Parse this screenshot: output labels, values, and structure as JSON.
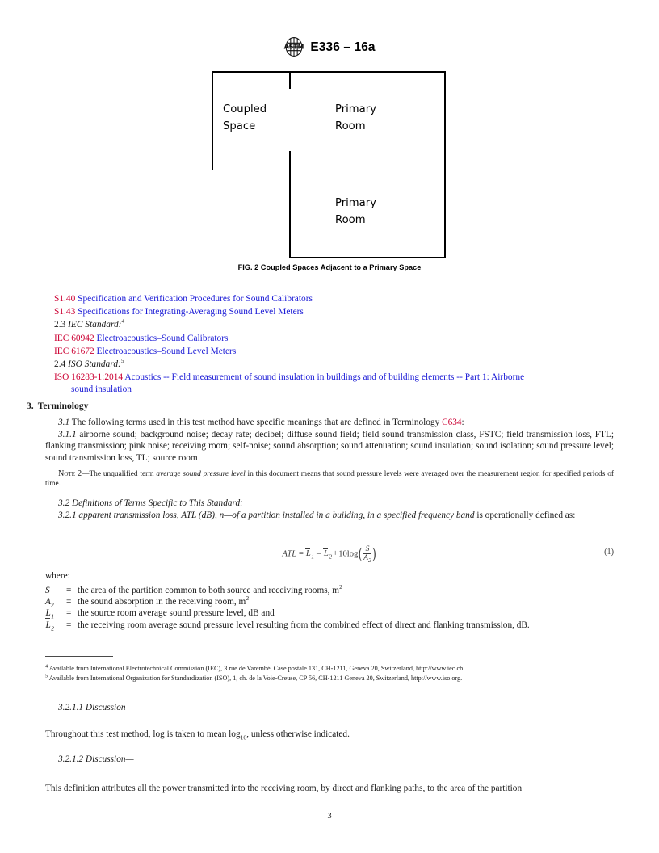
{
  "header": {
    "logo_icon": "astm-logo-icon",
    "designation": "E336 – 16a"
  },
  "figure": {
    "caption": "FIG. 2 Coupled Spaces Adjacent to a Primary Space",
    "rooms": [
      {
        "id": "coupled-space",
        "label": "Coupled\nSpace"
      },
      {
        "id": "primary-room-upper",
        "label": "Primary\nRoom"
      },
      {
        "id": "primary-room-lower",
        "label": "Primary\nRoom"
      }
    ]
  },
  "references": {
    "items": [
      {
        "designation": "S1.40",
        "title": "Specification and Verification Procedures for Sound Calibrators"
      },
      {
        "designation": "S1.43",
        "title": "Specifications for Integrating-Averaging Sound Level Meters"
      }
    ],
    "iec_heading_number": "2.3",
    "iec_heading": "IEC Standard:",
    "iec_heading_footnote": "4",
    "iec_items": [
      {
        "designation": "IEC 60942",
        "title": "Electroacoustics–Sound Calibrators"
      },
      {
        "designation": "IEC 61672",
        "title": "Electroacoustics–Sound Level Meters"
      }
    ],
    "iso_heading_number": "2.4",
    "iso_heading": "ISO Standard:",
    "iso_heading_footnote": "5",
    "iso_items": [
      {
        "designation": "ISO 16283-1:2014",
        "title": "Acoustics -- Field measurement of sound insulation in buildings and of building elements -- Part 1: Airborne",
        "title_cont": "sound insulation"
      }
    ]
  },
  "terminology": {
    "section_number": "3.",
    "section_title": "Terminology",
    "p31_number": "3.1",
    "p31_text_before": "The following terms used in this test method have specific meanings that are defined in Terminology",
    "p31_ref": "C634",
    "p31_text_after": ":",
    "p311_number": "3.1.1",
    "p311_text": "airborne sound; background noise; decay rate; decibel; diffuse sound field; field sound transmission class, FSTC; field transmission loss, FTL; flanking transmission; pink noise; receiving room; self-noise; sound absorption; sound attenuation; sound insulation; sound isolation; sound pressure level; sound transmission loss, TL; source room",
    "note_label": "Note 2",
    "note_text_before": "—The unqualified term",
    "note_italic": "average sound pressure level",
    "note_text_after": "in this document means that sound pressure levels were averaged over the measurement region for specified periods of time.",
    "p32_number": "3.2",
    "p32_title": "Definitions of Terms Specific to This Standard:",
    "p321_number": "3.2.1",
    "p321_italic": "apparent transmission loss, ATL (dB), n—of a partition installed in a building, in a specified frequency band",
    "p321_tail": "is operationally defined as:"
  },
  "equation": {
    "number": "(1)",
    "lhs": "ATL",
    "equals": "=",
    "term_l1": "L",
    "term_l1_sub": "1",
    "minus": "–",
    "term_l2": "L",
    "term_l2_sub": "2",
    "plus": "+",
    "log_coefficient": "10log",
    "numerator": "S",
    "denominator": "A",
    "denominator_sub": "2"
  },
  "where": {
    "lead": "where:",
    "definitions": [
      {
        "symbol": "S",
        "symbol_sub": "",
        "symbol_bar": false,
        "eq": "=",
        "text": "the area of the partition common to both source and receiving rooms, m",
        "superscript": "2"
      },
      {
        "symbol": "A",
        "symbol_sub": "2",
        "symbol_bar": false,
        "eq": "=",
        "text": "the sound absorption in the receiving room, m",
        "superscript": "2"
      },
      {
        "symbol": "L",
        "symbol_sub": "1",
        "symbol_bar": true,
        "eq": "=",
        "text": "the source room average sound pressure level, dB and",
        "superscript": ""
      },
      {
        "symbol": "L",
        "symbol_sub": "2",
        "symbol_bar": true,
        "eq": "=",
        "text": "the receiving room average sound pressure level resulting from the combined effect of direct and flanking transmission, dB.",
        "superscript": ""
      }
    ]
  },
  "footnotes": [
    {
      "marker": "4",
      "text": "Available from International Electrotechnical Commission (IEC), 3 rue de Varembé, Case postale 131, CH-1211, Geneva 20, Switzerland, http://www.iec.ch."
    },
    {
      "marker": "5",
      "text": "Available from International Organization for Standardization (ISO), 1, ch. de la Voie-Creuse, CP 56, CH-1211 Geneva 20, Switzerland, http://www.iso.org."
    }
  ],
  "discussions": [
    {
      "number": "3.2.1.1",
      "label": "Discussion—",
      "body_before": "Throughout this test method, log is taken to mean log",
      "body_sub": "10",
      "body_after": ", unless otherwise indicated."
    },
    {
      "number": "3.2.1.2",
      "label": "Discussion—",
      "body_before": "This definition attributes all the power transmitted into the receiving room, by direct and flanking paths, to the area of the partition",
      "body_sub": "",
      "body_after": ""
    }
  ],
  "page_number": "3",
  "colors": {
    "reference_designation": "#cc0033",
    "reference_title": "#1a1ad6",
    "text": "#1a1a1a"
  }
}
